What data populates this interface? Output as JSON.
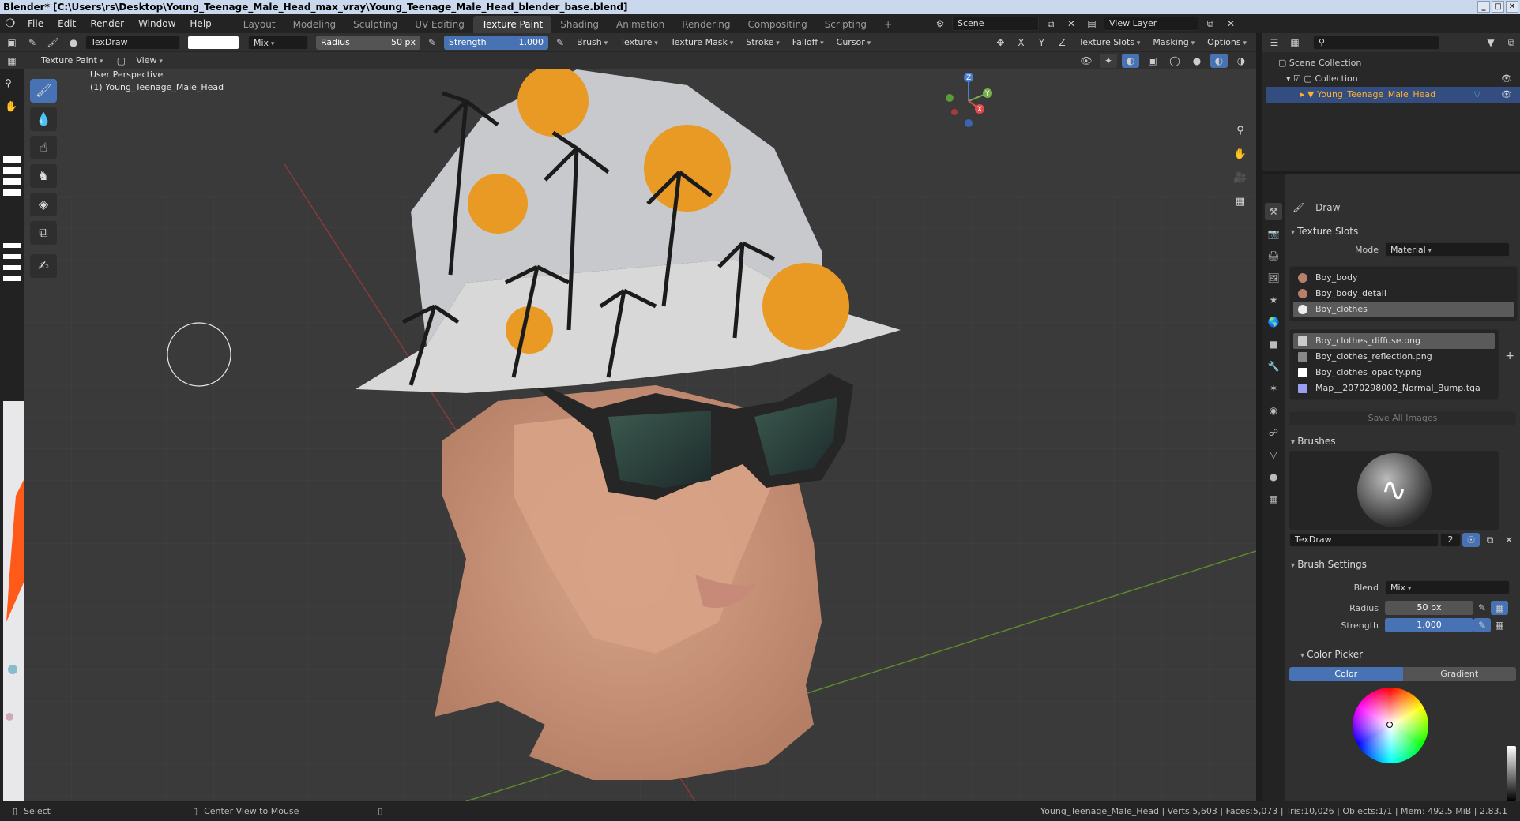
{
  "window": {
    "title": "Blender* [C:\\Users\\rs\\Desktop\\Young_Teenage_Male_Head_max_vray\\Young_Teenage_Male_Head_blender_base.blend]",
    "controls": [
      "_",
      "□",
      "✕"
    ]
  },
  "menu": [
    "File",
    "Edit",
    "Render",
    "Window",
    "Help"
  ],
  "workspaces": [
    {
      "label": "Layout",
      "active": false
    },
    {
      "label": "Modeling",
      "active": false
    },
    {
      "label": "Sculpting",
      "active": false
    },
    {
      "label": "UV Editing",
      "active": false
    },
    {
      "label": "Texture Paint",
      "active": true
    },
    {
      "label": "Shading",
      "active": false
    },
    {
      "label": "Animation",
      "active": false
    },
    {
      "label": "Rendering",
      "active": false
    },
    {
      "label": "Compositing",
      "active": false
    },
    {
      "label": "Scripting",
      "active": false
    }
  ],
  "workspace_add": "+",
  "scene": {
    "name": "Scene",
    "view_layer": "View Layer"
  },
  "toolbar": {
    "brush_name": "TexDraw",
    "blend": "Mix",
    "radius_label": "Radius",
    "radius_value": "50 px",
    "strength_label": "Strength",
    "strength_value": "1.000",
    "menus": [
      "Brush",
      "Texture",
      "Texture Mask",
      "Stroke",
      "Falloff",
      "Cursor"
    ],
    "axes": [
      "X",
      "Y",
      "Z"
    ],
    "right_menus": [
      "Texture Slots",
      "Masking",
      "Options"
    ]
  },
  "toolbar2": {
    "mode": "Texture Paint",
    "view": "View"
  },
  "viewport": {
    "perspective": "User Perspective",
    "object": "(1) Young_Teenage_Male_Head",
    "axis_x": "X",
    "axis_y": "Y",
    "axis_z": "Z"
  },
  "outliner": {
    "root": "Scene Collection",
    "collection": "Collection",
    "object": "Young_Teenage_Male_Head"
  },
  "props": {
    "tool_name": "Draw",
    "texture_slots": {
      "title": "Texture Slots",
      "mode_label": "Mode",
      "mode_value": "Material",
      "materials": [
        "Boy_body",
        "Boy_body_detail",
        "Boy_clothes"
      ],
      "images": [
        "Boy_clothes_diffuse.png",
        "Boy_clothes_reflection.png",
        "Boy_clothes_opacity.png",
        "Map__2070298002_Normal_Bump.tga"
      ],
      "save_all": "Save All Images"
    },
    "brushes": {
      "title": "Brushes",
      "name": "TexDraw",
      "users": "2"
    },
    "brush_settings": {
      "title": "Brush Settings",
      "blend_label": "Blend",
      "blend_value": "Mix",
      "radius_label": "Radius",
      "radius_value": "50 px",
      "strength_label": "Strength",
      "strength_value": "1.000"
    },
    "color_picker": {
      "title": "Color Picker",
      "tab_color": "Color",
      "tab_gradient": "Gradient"
    }
  },
  "status": {
    "select": "Select",
    "center_view": "Center View to Mouse",
    "stats": "Young_Teenage_Male_Head | Verts:5,603 | Faces:5,073 | Tris:10,026 | Objects:1/1 | Mem: 492.5 MiB | 2.83.1"
  },
  "colors": {
    "accent": "#4772b3",
    "hat_orange": "#e89a24",
    "skin": "#c89478"
  }
}
